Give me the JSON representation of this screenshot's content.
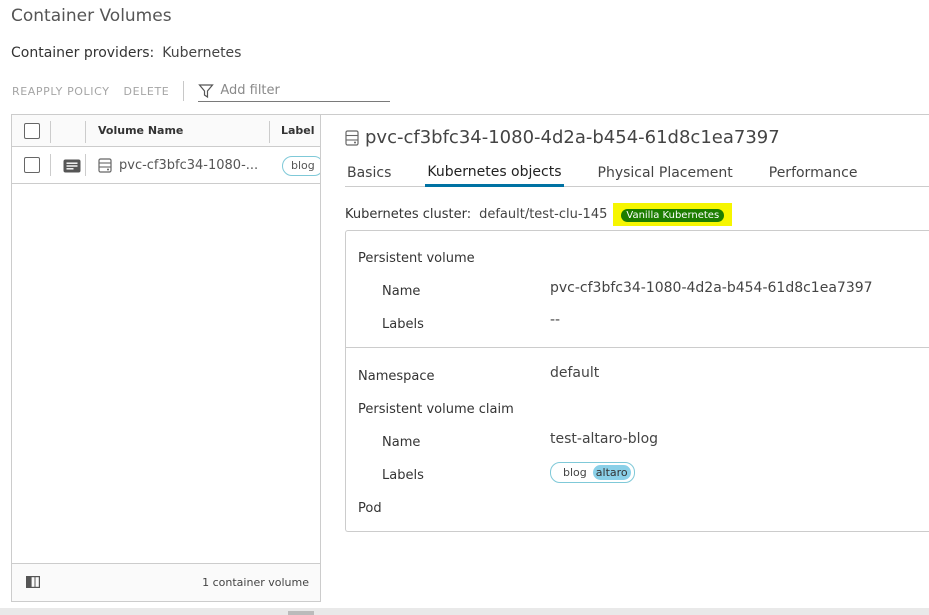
{
  "page": {
    "title": "Container Volumes",
    "providers_label": "Container providers:",
    "providers_value": "Kubernetes"
  },
  "toolbar": {
    "reapply": "REAPPLY POLICY",
    "delete": "DELETE",
    "filter_placeholder": "Add filter"
  },
  "grid": {
    "columns": [
      "Volume Name",
      "Label"
    ],
    "rows": [
      {
        "name": "pvc-cf3bfc34-1080-...",
        "label": "blog"
      }
    ],
    "footer_count": "1 container volume"
  },
  "detail": {
    "title": "pvc-cf3bfc34-1080-4d2a-b454-61d8c1ea7397",
    "tabs": [
      "Basics",
      "Kubernetes objects",
      "Physical Placement",
      "Performance"
    ],
    "active_tab": "Kubernetes objects",
    "cluster_label": "Kubernetes cluster:",
    "cluster_value": "default/test-clu-145",
    "cluster_badge": "Vanilla Kubernetes",
    "pv": {
      "section": "Persistent volume",
      "name_label": "Name",
      "name_value": "pvc-cf3bfc34-1080-4d2a-b454-61d8c1ea7397",
      "labels_label": "Labels",
      "labels_value": "--"
    },
    "namespace_label": "Namespace",
    "namespace_value": "default",
    "pvc": {
      "section": "Persistent volume claim",
      "name_label": "Name",
      "name_value": "test-altaro-blog",
      "labels_label": "Labels",
      "label_key": "blog",
      "label_value": "altaro"
    },
    "pod_label": "Pod"
  },
  "colors": {
    "accent": "#0072a3",
    "badge_bg": "#1c7d00",
    "highlight": "#f6f600",
    "pill_border": "#7fc9d8"
  }
}
